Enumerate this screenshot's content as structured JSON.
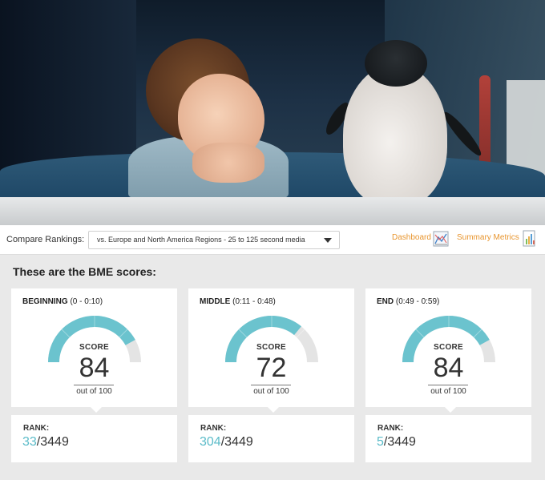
{
  "compare": {
    "label": "Compare Rankings:",
    "selected": "vs. Europe and North America Regions - 25 to 125 second media"
  },
  "nav": {
    "dashboard": "Dashboard",
    "summary": "Summary Metrics"
  },
  "section_title": "These are the BME scores:",
  "colors": {
    "gauge_fill": "#6bc3ce",
    "gauge_track": "#e4e4e4",
    "accent_link": "#e8952e",
    "rank_highlight": "#5cbcc9"
  },
  "cards": [
    {
      "title": "BEGINNING",
      "range": "(0 - 0:10)",
      "score_label": "SCORE",
      "score": "84",
      "out_of": "out of 100",
      "score_fraction": 0.84,
      "rank_label": "RANK:",
      "rank": "33",
      "rank_total": "/3449"
    },
    {
      "title": "MIDDLE",
      "range": "(0:11 - 0:48)",
      "score_label": "SCORE",
      "score": "72",
      "out_of": "out of 100",
      "score_fraction": 0.72,
      "rank_label": "RANK:",
      "rank": "304",
      "rank_total": "/3449"
    },
    {
      "title": "END",
      "range": "(0:49 - 0:59)",
      "score_label": "SCORE",
      "score": "84",
      "out_of": "out of 100",
      "score_fraction": 0.84,
      "rank_label": "RANK:",
      "rank": "5",
      "rank_total": "/3449"
    }
  ]
}
